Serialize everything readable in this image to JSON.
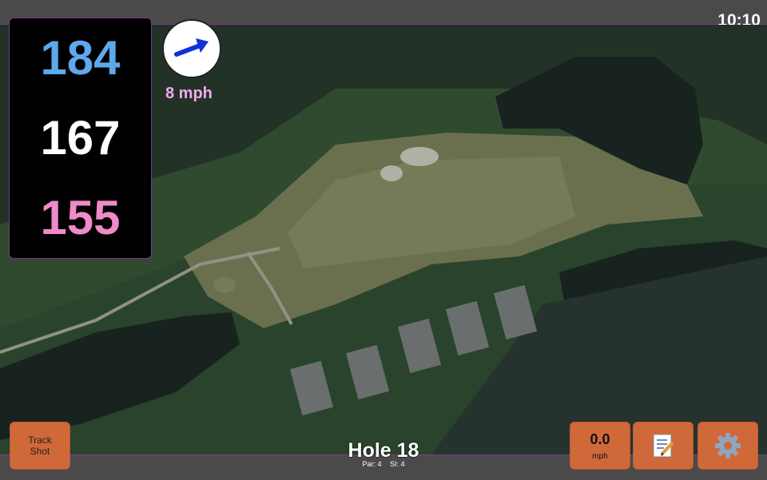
{
  "status": {
    "time": "10:10"
  },
  "distances": {
    "back": "184",
    "middle": "167",
    "front": "155"
  },
  "wind": {
    "speed": "8 mph",
    "arrow_icon": "arrow-right-icon"
  },
  "buttons": {
    "track_shot_line1": "Track",
    "track_shot_line2": "Shot",
    "speed_value": "0.0",
    "speed_unit": "mph",
    "notes_icon": "memo-icon",
    "settings_icon": "gear-icon"
  },
  "hole": {
    "title": "Hole 18",
    "par": "Par: 4",
    "si": "SI: 4"
  },
  "colors": {
    "accent": "#d0693a",
    "back_distance": "#5ea8ec",
    "front_distance": "#f08ac8",
    "border": "#7a3a8c"
  }
}
